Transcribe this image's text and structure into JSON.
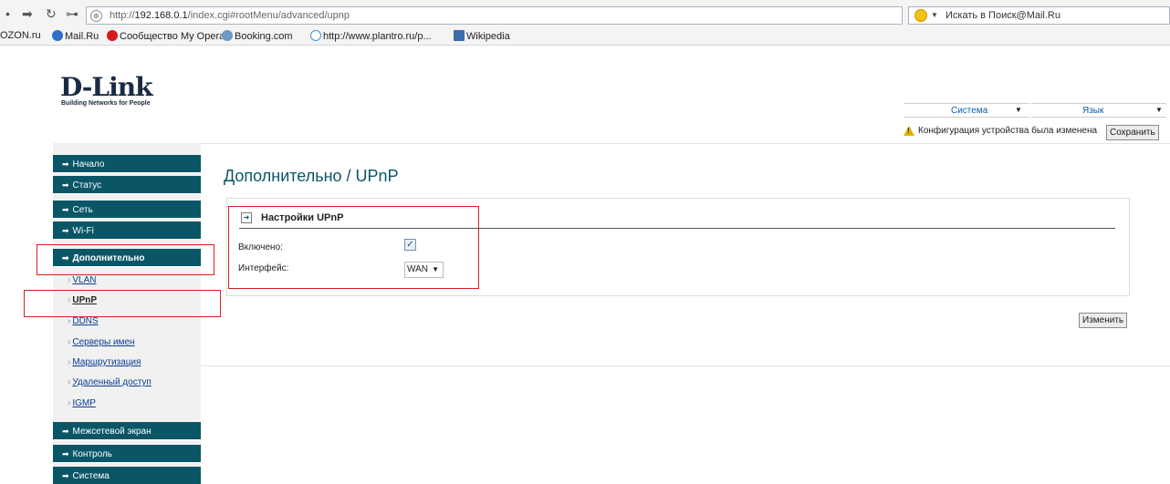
{
  "browser": {
    "url_prefix": "http://",
    "url_host": "192.168.0.1",
    "url_path": "/index.cgi#rootMenu/advanced/upnp",
    "search_placeholder": "Искать в Поиск@Mail.Ru"
  },
  "bookmarks": [
    {
      "label": "OZON.ru",
      "icon": "ozon-icon"
    },
    {
      "label": "Mail.Ru",
      "icon": "mailru-icon"
    },
    {
      "label": "Сообщество My Opera",
      "icon": "opera-icon"
    },
    {
      "label": "Booking.com",
      "icon": "booking-icon"
    },
    {
      "label": "http://www.plantro.ru/p...",
      "icon": "web-icon"
    },
    {
      "label": "Wikipedia",
      "icon": "wikipedia-icon"
    }
  ],
  "logo": {
    "name": "D-Link",
    "tagline": "Building Networks for People"
  },
  "header": {
    "system_select": "Система",
    "language_select": "Язык",
    "notice": "Конфигурация устройства была изменена",
    "save_label": "Сохранить"
  },
  "sidebar": {
    "main_top": [
      {
        "label": "Начало"
      },
      {
        "label": "Статус"
      },
      {
        "label": "Сеть"
      },
      {
        "label": "Wi-Fi"
      },
      {
        "label": "Дополнительно",
        "active": true
      }
    ],
    "sub": [
      {
        "label": "VLAN"
      },
      {
        "label": "UPnP",
        "active": true
      },
      {
        "label": "DDNS"
      },
      {
        "label": "Серверы имен"
      },
      {
        "label": "Маршрутизация"
      },
      {
        "label": "Удаленный доступ"
      },
      {
        "label": "IGMP"
      }
    ],
    "main_bottom": [
      {
        "label": "Межсетевой экран"
      },
      {
        "label": "Контроль"
      },
      {
        "label": "Система"
      }
    ]
  },
  "main": {
    "title": "Дополнительно / UPnP",
    "section_title": "Настройки UPnP",
    "enabled_label": "Включено:",
    "enabled_checked": true,
    "interface_label": "Интерфейс:",
    "interface_value": "WAN",
    "change_label": "Изменить"
  },
  "colors": {
    "menu_bg": "#0a5667",
    "annotation": "#d62020",
    "title": "#0a5667"
  }
}
